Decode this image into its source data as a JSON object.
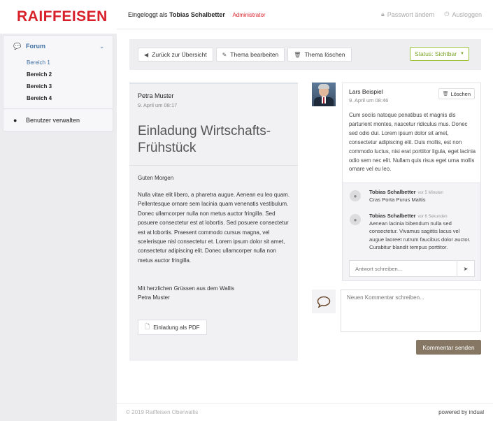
{
  "brand": {
    "logo_text": "RAIFFEISEN",
    "color": "#d8202b"
  },
  "header": {
    "logged_in_prefix": "Eingeloggt als",
    "user_name": "Tobias Schalbetter",
    "role": "Administrator",
    "change_password": "Passwort ändern",
    "logout": "Ausloggen"
  },
  "sidebar": {
    "forum_label": "Forum",
    "items": [
      {
        "label": "Bereich 1",
        "active": true
      },
      {
        "label": "Bereich 2"
      },
      {
        "label": "Bereich 3"
      },
      {
        "label": "Bereich 4"
      }
    ],
    "manage_users": "Benutzer verwalten"
  },
  "toolbar": {
    "back": "Zurück zur Übersicht",
    "edit": "Thema bearbeiten",
    "delete": "Thema löschen",
    "status": "Status: Sichtbar",
    "status_color": "#7ba526"
  },
  "post": {
    "author": "Petra Muster",
    "date": "9. April um 08:17",
    "title": "Einladung Wirtschafts-Frühstück",
    "greeting": "Guten Morgen",
    "body": "Nulla vitae elit libero, a pharetra augue. Aenean eu leo quam. Pellentesque ornare sem lacinia quam venenatis vestibulum. Donec ullamcorper nulla non metus auctor fringilla. Sed posuere consectetur est at lobortis. Sed posuere consectetur est at lobortis. Praesent commodo cursus magna, vel scelerisque nisl consectetur et. Lorem ipsum dolor sit amet, consectetur adipiscing elit. Donec ullamcorper nulla non metus auctor fringilla.",
    "closing": "Mit herzlichen Grüssen aus dem Wallis\nPetra Muster",
    "pdf_button": "Einladung als PDF"
  },
  "comment": {
    "author": "Lars Beispiel",
    "date": "9. April um 08:46",
    "delete": "Löschen",
    "text": "Cum sociis natoque penatibus et magnis dis parturient montes, nascetur ridiculus mus. Donec sed odio dui. Lorem ipsum dolor sit amet, consectetur adipiscing elit. Duis mollis, est non commodo luctus, nisi erat porttitor ligula, eget lacinia odio sem nec elit. Nullam quis risus eget urna mollis ornare vel eu leo.",
    "replies": [
      {
        "name": "Tobias Schalbetter",
        "time": "vor 5 Minuten",
        "text": "Cras Porta Purus Mattis"
      },
      {
        "name": "Tobias Schalbetter",
        "time": "vor 6 Sekunden",
        "text": "Aenean lacinia bibendum nulla sed consectetur. Vivamus sagittis lacus vel augue laoreet rutrum faucibus dolor auctor. Curabitur blandit tempus porttitor."
      }
    ],
    "reply_placeholder": "Antwort schreiben..."
  },
  "new_comment": {
    "placeholder": "Neuen Kommentar schreiben...",
    "submit": "Kommentar senden",
    "submit_color": "#857764"
  },
  "footer": {
    "copyright": "© 2019 Raiffeisen Oberwallis",
    "powered": "powered by indual"
  }
}
